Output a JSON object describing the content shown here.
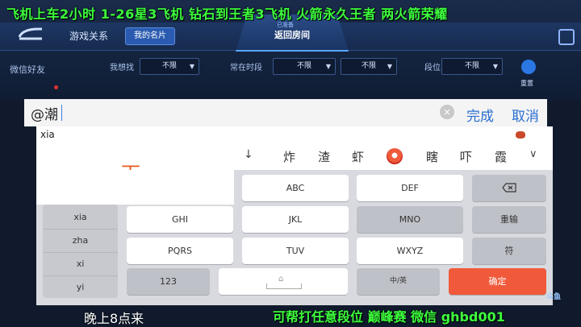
{
  "overlay": {
    "top_text": "飞机上车2小时  1-26星3飞机  钻石到王者3飞机  火箭永久王者 两火箭荣耀",
    "bottom_left": "晚上8点来",
    "bottom_right": "可帮打任意段位 巅峰赛   微信 ghbd001",
    "logo_text": "斗鱼"
  },
  "game": {
    "tabs": {
      "relations": "游戏关系",
      "my_card": "我的名片"
    },
    "banner_small": "已准备",
    "banner_title": "返回房间",
    "sidebar_label": "微信好友",
    "filters": {
      "want_label": "我想找",
      "want_value": "不限",
      "time_label": "常在时段",
      "time_value1": "不限",
      "time_value2": "不限",
      "rank_label": "段位",
      "rank_value": "不限"
    },
    "reset_label": "重置"
  },
  "input": {
    "value": "@潮",
    "clear_label": "×",
    "done_label": "完成",
    "cancel_label": "取消"
  },
  "ime": {
    "pinyin": "xia",
    "preview": "下",
    "arrow": "↓",
    "candidates": [
      "炸",
      "渣",
      "虾",
      "瞎",
      "吓",
      "霞"
    ],
    "expand": "∨",
    "syllables": [
      "xia",
      "zha",
      "xi",
      "yi"
    ],
    "keys": {
      "abc": "ABC",
      "def": "DEF",
      "ghi": "GHI",
      "jkl": "JKL",
      "mno": "MNO",
      "reinput": "重输",
      "pqrs": "PQRS",
      "tuv": "TUV",
      "wxyz": "WXYZ",
      "symbol": "符",
      "num": "123",
      "lang": "中/英",
      "confirm": "确定",
      "space_hint": "⌂"
    }
  }
}
